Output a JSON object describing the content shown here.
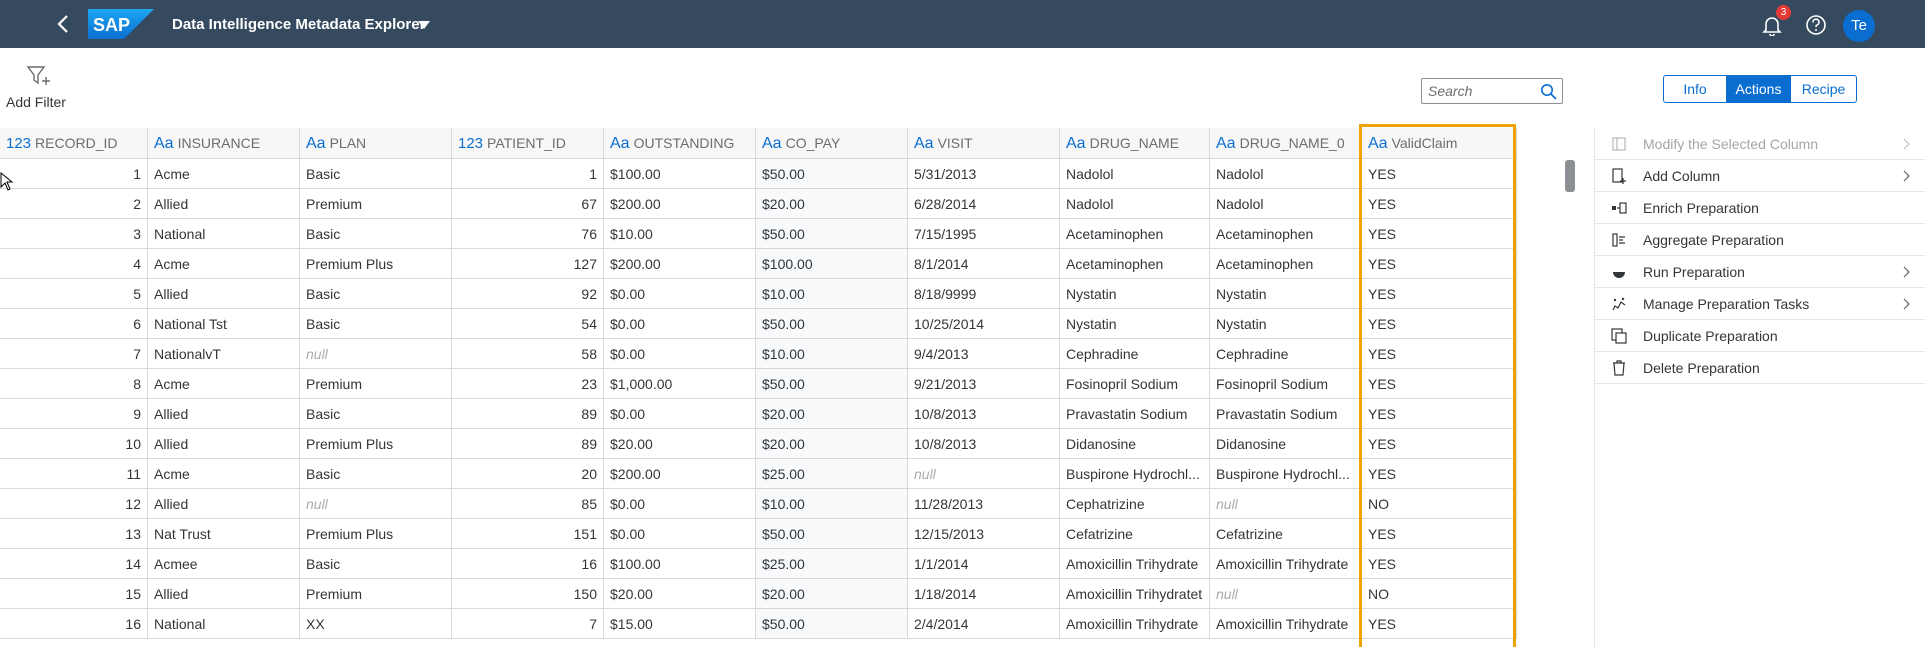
{
  "shellbar": {
    "logo_text": "SAP",
    "title": "Data Intelligence Metadata Explorer",
    "notification_count": "3",
    "avatar_initials": "Te",
    "colors": {
      "bar": "#354a5f",
      "badge": "#e53935",
      "avatar": "#0a6ed1"
    }
  },
  "toolbar": {
    "add_filter_label": "Add Filter",
    "search_placeholder": "Search",
    "view_tabs": [
      "Info",
      "Actions",
      "Recipe"
    ],
    "active_tab": "Actions"
  },
  "grid": {
    "columns": [
      {
        "type": "123",
        "name": "RECORD_ID"
      },
      {
        "type": "Aa",
        "name": "INSURANCE"
      },
      {
        "type": "Aa",
        "name": "PLAN"
      },
      {
        "type": "123",
        "name": "PATIENT_ID"
      },
      {
        "type": "Aa",
        "name": "OUTSTANDING"
      },
      {
        "type": "Aa",
        "name": "CO_PAY"
      },
      {
        "type": "Aa",
        "name": "VISIT"
      },
      {
        "type": "Aa",
        "name": "DRUG_NAME"
      },
      {
        "type": "Aa",
        "name": "DRUG_NAME_0"
      },
      {
        "type": "Aa",
        "name": "ValidClaim"
      }
    ],
    "highlighted_column": "ValidClaim",
    "highlight_color": "#f0a30a",
    "null_text": "null",
    "rows": [
      [
        "1",
        "Acme",
        "Basic",
        "1",
        "$100.00",
        "$50.00",
        "5/31/2013",
        "Nadolol",
        "Nadolol",
        "YES"
      ],
      [
        "2",
        "Allied",
        "Premium",
        "67",
        "$200.00",
        "$20.00",
        "6/28/2014",
        "Nadolol",
        "Nadolol",
        "YES"
      ],
      [
        "3",
        "National",
        "Basic",
        "76",
        "$10.00",
        "$50.00",
        "7/15/1995",
        "Acetaminophen",
        "Acetaminophen",
        "YES"
      ],
      [
        "4",
        "Acme",
        "Premium Plus",
        "127",
        "$200.00",
        "$100.00",
        "8/1/2014",
        "Acetaminophen",
        "Acetaminophen",
        "YES"
      ],
      [
        "5",
        "Allied",
        "Basic",
        "92",
        "$0.00",
        "$10.00",
        "8/18/9999",
        "Nystatin",
        "Nystatin",
        "YES"
      ],
      [
        "6",
        "National Tst",
        "Basic",
        "54",
        "$0.00",
        "$50.00",
        "10/25/2014",
        "Nystatin",
        "Nystatin",
        "YES"
      ],
      [
        "7",
        "NationalvT",
        "null",
        "58",
        "$0.00",
        "$10.00",
        "9/4/2013",
        "Cephradine",
        "Cephradine",
        "YES"
      ],
      [
        "8",
        "Acme",
        "Premium",
        "23",
        "$1,000.00",
        "$50.00",
        "9/21/2013",
        "Fosinopril Sodium",
        "Fosinopril Sodium",
        "YES"
      ],
      [
        "9",
        "Allied",
        "Basic",
        "89",
        "$0.00",
        "$20.00",
        "10/8/2013",
        "Pravastatin Sodium",
        "Pravastatin Sodium",
        "YES"
      ],
      [
        "10",
        "Allied",
        "Premium Plus",
        "89",
        "$20.00",
        "$20.00",
        "10/8/2013",
        "Didanosine",
        "Didanosine",
        "YES"
      ],
      [
        "11",
        "Acme",
        "Basic",
        "20",
        "$200.00",
        "$25.00",
        "null",
        "Buspirone Hydrochl...",
        "Buspirone Hydrochl...",
        "YES"
      ],
      [
        "12",
        "Allied",
        "null",
        "85",
        "$0.00",
        "$10.00",
        "11/28/2013",
        "Cephatrizine",
        "null",
        "NO"
      ],
      [
        "13",
        "Nat Trust",
        "Premium Plus",
        "151",
        "$0.00",
        "$50.00",
        "12/15/2013",
        "Cefatrizine",
        "Cefatrizine",
        "YES"
      ],
      [
        "14",
        "Acmee",
        "Basic",
        "16",
        "$100.00",
        "$25.00",
        "1/1/2014",
        "Amoxicillin Trihydrate",
        "Amoxicillin Trihydrate",
        "YES"
      ],
      [
        "15",
        "Allied",
        "Premium",
        "150",
        "$20.00",
        "$20.00",
        "1/18/2014",
        "Amoxicillin Trihydratet",
        "null",
        "NO"
      ],
      [
        "16",
        "National",
        "XX",
        "7",
        "$15.00",
        "$50.00",
        "2/4/2014",
        "Amoxicillin Trihydrate",
        "Amoxicillin Trihydrate",
        "YES"
      ]
    ]
  },
  "actions_panel": {
    "items": [
      {
        "label": "Modify the Selected Column",
        "icon": "modify-column-icon",
        "disabled": true,
        "submenu": true
      },
      {
        "label": "Add Column",
        "icon": "add-column-icon",
        "disabled": false,
        "submenu": true
      },
      {
        "label": "Enrich Preparation",
        "icon": "enrich-icon",
        "disabled": false,
        "submenu": false
      },
      {
        "label": "Aggregate Preparation",
        "icon": "aggregate-icon",
        "disabled": false,
        "submenu": false
      },
      {
        "label": "Run Preparation",
        "icon": "run-icon",
        "disabled": false,
        "submenu": true
      },
      {
        "label": "Manage Preparation Tasks",
        "icon": "manage-tasks-icon",
        "disabled": false,
        "submenu": true
      },
      {
        "label": "Duplicate Preparation",
        "icon": "duplicate-icon",
        "disabled": false,
        "submenu": false
      },
      {
        "label": "Delete Preparation",
        "icon": "delete-icon",
        "disabled": false,
        "submenu": false
      }
    ]
  }
}
